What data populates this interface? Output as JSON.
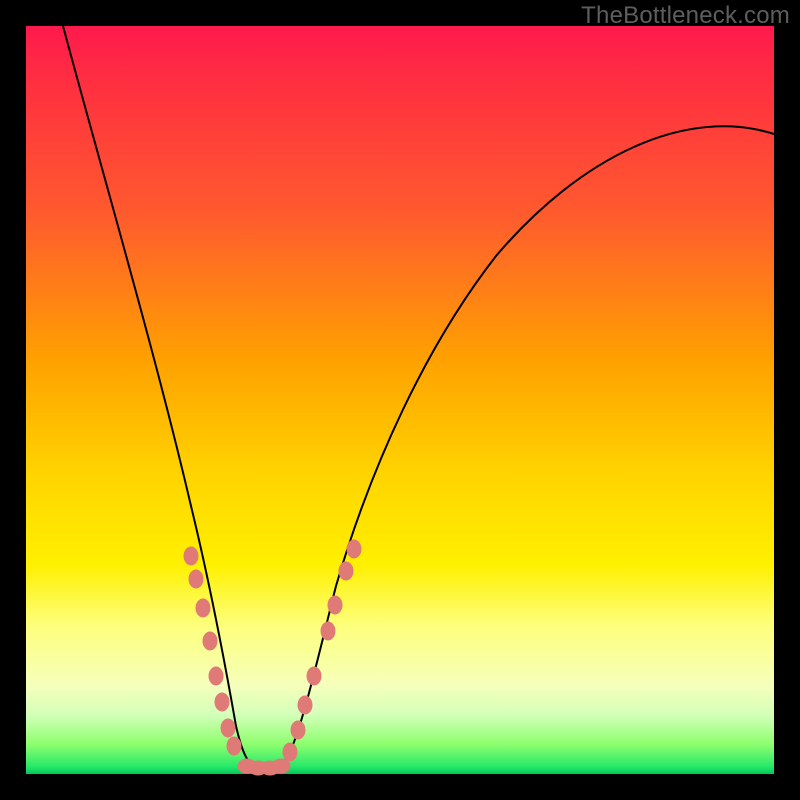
{
  "watermark": "TheBottleneck.com",
  "colors": {
    "frame": "#000000",
    "gradient_top": "#ff1a4d",
    "gradient_mid": "#ffd400",
    "gradient_bottom": "#00c858",
    "curve": "#000000",
    "marker": "#e07a76"
  },
  "chart_data": {
    "type": "line",
    "title": "",
    "xlabel": "",
    "ylabel": "",
    "xlim": [
      0,
      100
    ],
    "ylim": [
      0,
      100
    ],
    "grid": false,
    "legend": false,
    "note": "Axes have no numeric tick labels in the image; values are normalized 0-100 estimated from pixel position.",
    "series": [
      {
        "name": "left-branch",
        "x": [
          5,
          8,
          12,
          16,
          18,
          20,
          22,
          23.5,
          24.5,
          25.5,
          26.5,
          27.5,
          28.5
        ],
        "y": [
          100,
          82,
          60,
          42,
          35,
          28,
          22,
          17,
          13,
          9,
          6,
          3,
          1
        ]
      },
      {
        "name": "valley",
        "x": [
          28.5,
          30,
          31.5,
          33,
          34.5
        ],
        "y": [
          1,
          0,
          0,
          0,
          1
        ]
      },
      {
        "name": "right-branch",
        "x": [
          34.5,
          36,
          38,
          41,
          45,
          50,
          56,
          63,
          71,
          80,
          88,
          95,
          100
        ],
        "y": [
          1,
          3,
          8,
          14,
          22,
          31,
          41,
          51,
          61,
          70,
          77,
          82,
          85
        ]
      }
    ],
    "markers": {
      "name": "threshold-markers",
      "note": "Oval markers clustered near the valley on both branches and along the floor",
      "points": [
        {
          "x": 22.0,
          "y": 29.0
        },
        {
          "x": 22.8,
          "y": 26.0
        },
        {
          "x": 23.6,
          "y": 22.0
        },
        {
          "x": 24.6,
          "y": 17.5
        },
        {
          "x": 25.4,
          "y": 13.0
        },
        {
          "x": 26.2,
          "y": 9.5
        },
        {
          "x": 27.0,
          "y": 6.0
        },
        {
          "x": 27.7,
          "y": 3.5
        },
        {
          "x": 29.5,
          "y": 0.8
        },
        {
          "x": 31.0,
          "y": 0.6
        },
        {
          "x": 32.5,
          "y": 0.6
        },
        {
          "x": 34.0,
          "y": 0.8
        },
        {
          "x": 35.2,
          "y": 2.5
        },
        {
          "x": 36.3,
          "y": 5.5
        },
        {
          "x": 37.3,
          "y": 9.0
        },
        {
          "x": 38.5,
          "y": 13.0
        },
        {
          "x": 40.3,
          "y": 19.0
        },
        {
          "x": 41.3,
          "y": 22.5
        },
        {
          "x": 42.8,
          "y": 27.0
        },
        {
          "x": 43.8,
          "y": 30.0
        }
      ]
    }
  }
}
